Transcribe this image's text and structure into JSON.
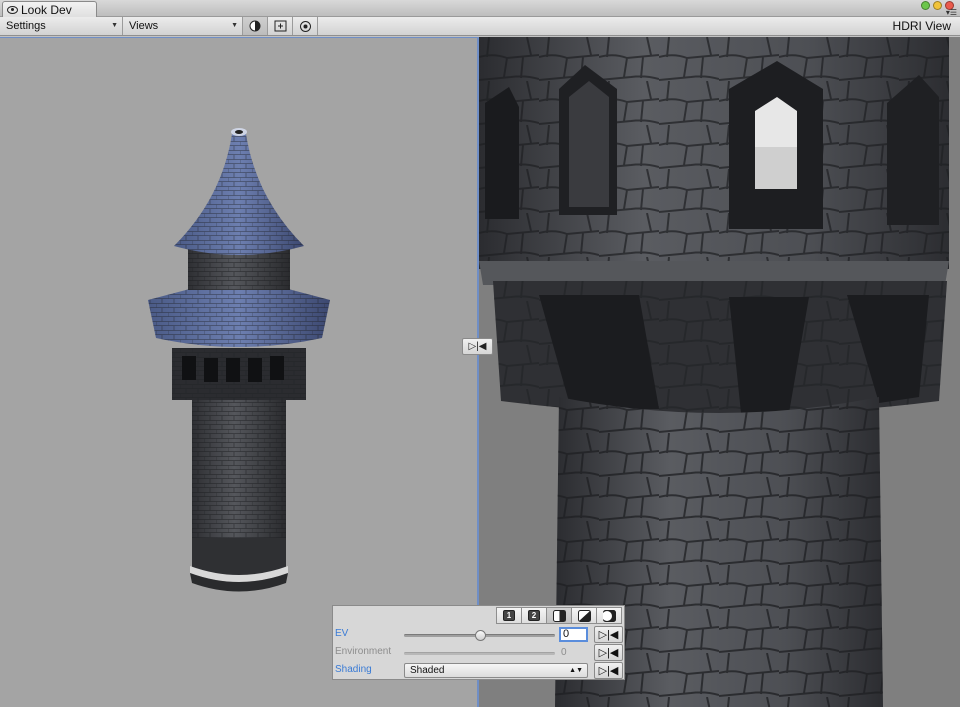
{
  "window": {
    "tab_label": "Look Dev"
  },
  "toolbar": {
    "settings_label": "Settings",
    "views_label": "Views",
    "hdri_view_label": "HDRI View"
  },
  "panel": {
    "ev": {
      "label": "EV",
      "value": "0",
      "slider_fraction": 0.5
    },
    "environment": {
      "label": "Environment",
      "value": "0",
      "slider_fraction": 0.0
    },
    "shading": {
      "label": "Shading",
      "selected": "Shaded"
    },
    "modes": [
      "1",
      "2",
      "split-vertical",
      "split-diagonal",
      "split-circle"
    ]
  },
  "colors": {
    "accent": "#3a7bd5",
    "viewport_left_bg": "#a4a4a4",
    "viewport_right_bg": "#7f7f7f"
  },
  "icons": {
    "tab": "eye-icon",
    "sync": "sync-views-icon"
  }
}
